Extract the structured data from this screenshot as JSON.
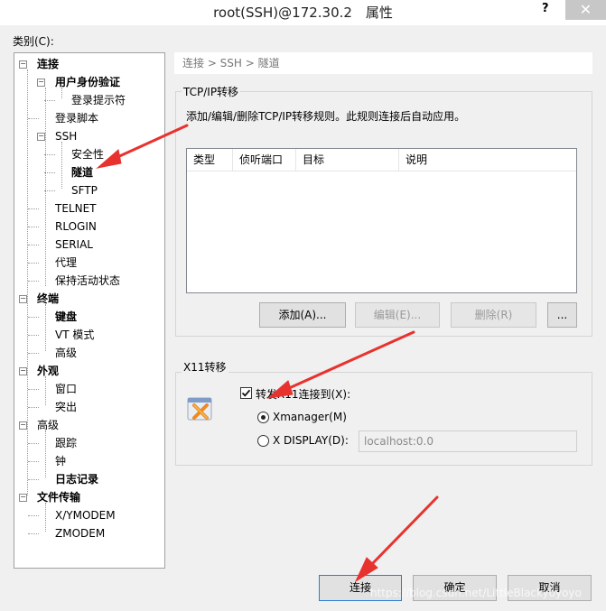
{
  "window": {
    "title": "root(SSH)@172.30.2     属性",
    "help": "?",
    "close": "✕"
  },
  "category_label": "类别(C):",
  "tree": [
    {
      "label": "连接",
      "bold": true,
      "toggle": "-"
    },
    {
      "label": "用户身份验证",
      "bold": true,
      "toggle": "-"
    },
    {
      "label": "登录提示符"
    },
    {
      "label": "登录脚本"
    },
    {
      "label": "SSH",
      "toggle": "-"
    },
    {
      "label": "安全性"
    },
    {
      "label": "隧道",
      "bold": true,
      "selected": true
    },
    {
      "label": "SFTP"
    },
    {
      "label": "TELNET"
    },
    {
      "label": "RLOGIN"
    },
    {
      "label": "SERIAL"
    },
    {
      "label": "代理"
    },
    {
      "label": "保持活动状态"
    },
    {
      "label": "终端",
      "bold": true,
      "toggle": "-"
    },
    {
      "label": "键盘",
      "bold": true
    },
    {
      "label": "VT 模式"
    },
    {
      "label": "高级"
    },
    {
      "label": "外观",
      "bold": true,
      "toggle": "-"
    },
    {
      "label": "窗口"
    },
    {
      "label": "突出"
    },
    {
      "label": "高级",
      "toggle": "-"
    },
    {
      "label": "跟踪"
    },
    {
      "label": "钟"
    },
    {
      "label": "日志记录",
      "bold": true
    },
    {
      "label": "文件传输",
      "bold": true,
      "toggle": "-"
    },
    {
      "label": "X/YMODEM"
    },
    {
      "label": "ZMODEM"
    }
  ],
  "breadcrumb": "连接 > SSH > 隧道",
  "tcp": {
    "group_title": "TCP/IP转移",
    "description": "添加/编辑/删除TCP/IP转移规则。此规则连接后自动应用。",
    "columns": [
      "类型",
      "侦听端口",
      "目标",
      "说明"
    ],
    "buttons": {
      "add": "添加(A)...",
      "edit": "编辑(E)...",
      "delete": "删除(R)",
      "more": "..."
    }
  },
  "x11": {
    "group_title": "X11转移",
    "checkbox_label": "转发X11连接到(X):",
    "checkbox_checked": true,
    "radio_xmanager": "Xmanager(M)",
    "radio_xdisplay": "X DISPLAY(D):",
    "selected_radio": "xmanager",
    "display_value": "localhost:0.0"
  },
  "footer": {
    "connect": "连接",
    "ok": "确定",
    "cancel": "取消"
  },
  "watermark": "https://blog.csdn.net/LittleBlackyoyoyo",
  "colors": {
    "annotation_arrow": "#e8322e",
    "selection": "#0078d7"
  }
}
